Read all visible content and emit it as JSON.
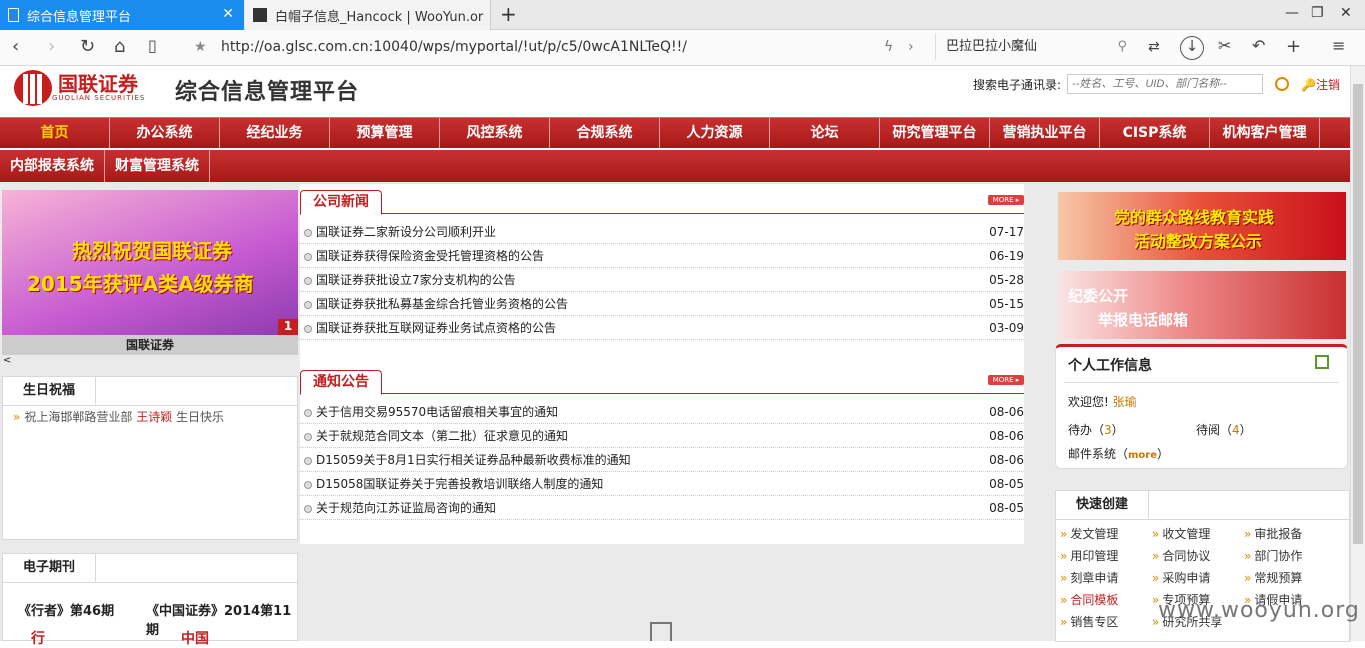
{
  "browser": {
    "tabs": [
      {
        "title": "综合信息管理平台",
        "active": true
      },
      {
        "title": "白帽子信息_Hancock | WooYun.or",
        "active": false
      }
    ],
    "url": "http://oa.glsc.com.cn:10040/wps/myportal/!ut/p/c5/0wcA1NLTeQ!!/",
    "search_text": "巴拉巴拉小魔仙"
  },
  "header": {
    "logo_cn": "国联证券",
    "logo_en": "GUOLIAN SECURITIES",
    "title": "综合信息管理平台",
    "search_label": "搜索电子通讯录:",
    "search_placeholder": "--姓名、工号、UID、部门名称--",
    "logout": "注销"
  },
  "menu1": [
    "首页",
    "办公系统",
    "经纪业务",
    "预算管理",
    "风控系统",
    "合规系统",
    "人力资源",
    "论坛",
    "研究管理平台",
    "营销执业平台",
    "CISP系统",
    "机构客户管理"
  ],
  "menu2": [
    "内部报表系统",
    "财富管理系统"
  ],
  "banner": {
    "line1": "热烈祝贺国联证券",
    "line2": "2015年获评A类A级券商",
    "number": "1",
    "caption": "国联证券",
    "nav": "<"
  },
  "birthday": {
    "tab": "生日祝福",
    "prefix": "祝上海邯郸路营业部",
    "name": "王诗颖",
    "suffix": "生日快乐"
  },
  "emag": {
    "tab": "电子期刊",
    "item1": "《行者》第46期",
    "item2": "《中国证券》2014第11期",
    "logo1": "行",
    "logo2": "中国"
  },
  "company_news": {
    "title": "公司新闻",
    "more": "MORE ▸",
    "items": [
      {
        "text": "国联证券二家新设分公司顺利开业",
        "date": "07-17"
      },
      {
        "text": "国联证券获得保险资金受托管理资格的公告",
        "date": "06-19"
      },
      {
        "text": "国联证券获批设立7家分支机构的公告",
        "date": "05-28"
      },
      {
        "text": "国联证券获批私募基金综合托管业务资格的公告",
        "date": "05-15"
      },
      {
        "text": "国联证券获批互联网证券业务试点资格的公告",
        "date": "03-09"
      }
    ]
  },
  "notices": {
    "title": "通知公告",
    "more": "MORE ▸",
    "items": [
      {
        "text": "关于信用交易95570电话留痕相关事宜的通知",
        "date": "08-06"
      },
      {
        "text": "关于就规范合同文本（第二批）征求意见的通知",
        "date": "08-06"
      },
      {
        "text": "D15059关于8月1日实行相关证券品种最新收费标准的通知",
        "date": "08-06"
      },
      {
        "text": "D15058国联证券关于完善投教培训联络人制度的通知",
        "date": "08-05"
      },
      {
        "text": "关于规范向江苏证监局咨询的通知",
        "date": "08-05"
      }
    ]
  },
  "right_banners": {
    "b1_line1": "党的群众路线教育实践",
    "b1_line2": "活动整改方案公示",
    "b2_line1": "纪委公开",
    "b2_line2": "举报电话邮箱"
  },
  "personal": {
    "title": "个人工作信息",
    "welcome": "欢迎您!",
    "user": "张瑜",
    "todo_label": "待办（",
    "todo": "3",
    "read_label": "待阅（",
    "read": "4",
    "close": "）",
    "mail_label": "邮件系统（",
    "mail_more": "more"
  },
  "quick": {
    "tab": "快速创建",
    "items": [
      "发文管理",
      "收文管理",
      "审批报备",
      "用印管理",
      "合同协议",
      "部门协作",
      "刻章申请",
      "采购申请",
      "常规预算",
      "合同模板",
      "专项预算",
      "请假申请",
      "销售专区",
      "研究所共享"
    ]
  },
  "watermark": "www.wooyun.org"
}
